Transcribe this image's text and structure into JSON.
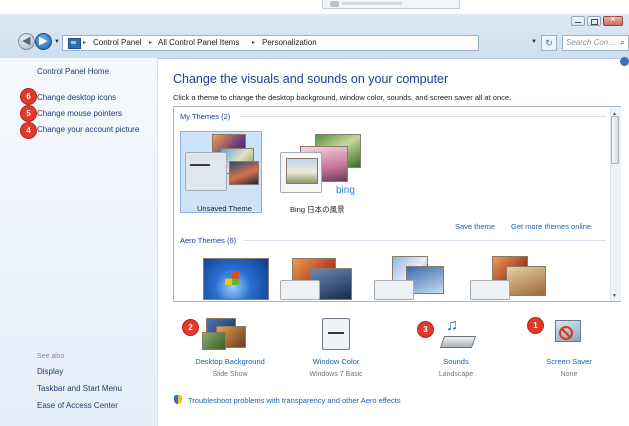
{
  "address_bar": {
    "crumbs": [
      "Control Panel",
      "All Control Panel Items",
      "Personalization"
    ],
    "search_placeholder": "Search Con..."
  },
  "left_pane": {
    "home": "Control Panel Home",
    "links": [
      "Change desktop icons",
      "Change mouse pointers",
      "Change your account picture"
    ],
    "link_badges": [
      "6",
      "5",
      "4"
    ],
    "see_also_title": "See also",
    "see_also": [
      "Display",
      "Taskbar and Start Menu",
      "Ease of Access Center"
    ]
  },
  "main": {
    "title": "Change the visuals and sounds on your computer",
    "subtitle": "Click a theme to change the desktop background, window color, sounds, and screen saver all at once."
  },
  "themes": {
    "my_themes_header": "My Themes (2)",
    "my_themes": [
      "Unsaved Theme",
      "Bing 日本の風景"
    ],
    "bing_logo_text": "bing",
    "save_theme": "Save theme",
    "get_more": "Get more themes online",
    "aero_header": "Aero Themes (6)"
  },
  "settings": [
    {
      "label": "Desktop Background",
      "sub": "Slide Show",
      "badge": "2",
      "icon": "desktop-background-icon"
    },
    {
      "label": "Window Color",
      "sub": "Windows 7 Basic",
      "badge": "",
      "icon": "window-color-icon"
    },
    {
      "label": "Sounds",
      "sub": "Landscape",
      "badge": "3",
      "icon": "sounds-icon"
    },
    {
      "label": "Screen Saver",
      "sub": "None",
      "badge": "1",
      "icon": "screen-saver-icon"
    }
  ],
  "troubleshoot": "Troubleshoot problems with transparency and other Aero effects",
  "colors": {
    "badge": "#e13a2a",
    "link": "#1f5fb0",
    "title": "#1e3d95",
    "selection": "#cfe3f8"
  }
}
